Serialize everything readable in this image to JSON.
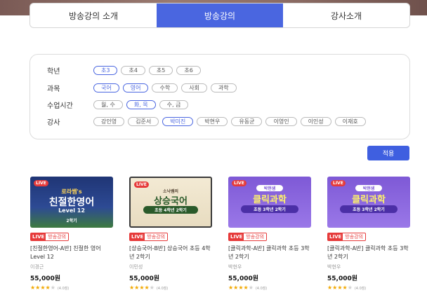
{
  "tabs": [
    {
      "label": "방송강의 소개",
      "active": false
    },
    {
      "label": "방송강의",
      "active": true
    },
    {
      "label": "강사소개",
      "active": false
    }
  ],
  "filters": {
    "grade": {
      "label": "학년",
      "options": [
        "초3",
        "초4",
        "초5",
        "초6"
      ],
      "selected": [
        "초3"
      ]
    },
    "subject": {
      "label": "과목",
      "options": [
        "국어",
        "영어",
        "수학",
        "사회",
        "과학"
      ],
      "selected": [
        "국어",
        "영어"
      ]
    },
    "time": {
      "label": "수업시간",
      "options": [
        "월, 수",
        "화, 목",
        "수, 금"
      ],
      "selected": [
        "화, 목"
      ]
    },
    "teacher": {
      "label": "강사",
      "options": [
        "강인영",
        "김준서",
        "박미진",
        "박현우",
        "유동균",
        "이영인",
        "이인성",
        "이재호"
      ],
      "selected": [
        "박미진"
      ]
    }
  },
  "apply_label": "적용",
  "badge": {
    "live": "LIVE",
    "label": "방송강의"
  },
  "courses": [
    {
      "thumb": {
        "live": "LIVE",
        "line1": "로라쌤's",
        "line2": "친절한영어",
        "line3": "Level 12",
        "line4": "2학기"
      },
      "title": "[친절한영어-A반] 친절한 영어 Level 12",
      "teacher": "이경근",
      "price": "55,000원",
      "rating": 4,
      "rating_text": "(4.0점)"
    },
    {
      "thumb": {
        "live": "LIVE",
        "line1": "소낙쌤의",
        "line2": "상승국어",
        "line3": "초등 4학년 2학기"
      },
      "title": "[상승국어-B반] 상승국어 초등 4학년 2학기",
      "teacher": "이민성",
      "price": "55,000원",
      "rating": 4,
      "rating_text": "(4.0점)"
    },
    {
      "thumb": {
        "live": "LIVE",
        "line1": "박현샘",
        "line2": "클릭과학",
        "line3": "초등 3학년 2학기"
      },
      "title": "[클릭과학-A반] 클릭과학 초등 3학년 2학기",
      "teacher": "박현우",
      "price": "55,000원",
      "rating": 4,
      "rating_text": "(4.0점)"
    },
    {
      "thumb": {
        "live": "LIVE",
        "line1": "박현샘",
        "line2": "클릭과학",
        "line3": "초등 3학년 2학기"
      },
      "title": "[클릭과학-A반] 클릭과학 초등 3학년 2학기",
      "teacher": "박현우",
      "price": "55,000원",
      "rating": 4,
      "rating_text": "(4.0점)"
    }
  ],
  "colors": {
    "accent": "#4a66e0",
    "live_red": "#e63a3a",
    "star": "#f2a800"
  }
}
